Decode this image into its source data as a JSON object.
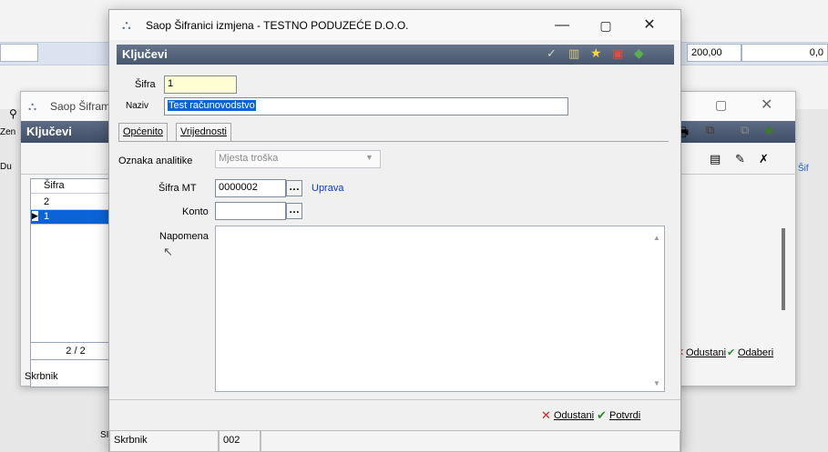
{
  "background": {
    "amount": "200,00",
    "right_amount": "0,0",
    "left_title": "Saop Šifram",
    "left_header": "Ključevi",
    "left_cut_top": "Zen",
    "left_cut_mid": "Du",
    "right_cut": "Šif",
    "grid_header": "Šifra",
    "rows": [
      "2",
      "1"
    ],
    "pager": "2 / 2",
    "footer_label": "Skrbnik",
    "footer_bottom": "SI",
    "buttons": {
      "cancel": "Odustani",
      "choose": "Odaberi"
    }
  },
  "dialog": {
    "title": "Saop Šifranici izmjena  - TESTNO PODUZEĆE D.O.O.",
    "header": "Ključevi",
    "sifra_label": "Šifra",
    "sifra_value": "1",
    "naziv_label": "Naziv",
    "naziv_value": "Test računovodstvo",
    "tabs": [
      "Općenito",
      "Vrijednosti"
    ],
    "oznaka_label": "Oznaka analitike",
    "oznaka_value": "Mjesta troška",
    "sifra_mt_label": "Šifra MT",
    "sifra_mt_value": "0000002",
    "sifra_mt_desc": "Uprava",
    "konto_label": "Konto",
    "napomena_label": "Napomena",
    "cancel": "Odustani",
    "confirm": "Potvrdi",
    "status_label": "Skrbnik",
    "status_value": "002"
  },
  "colors": {
    "header": "#53627a",
    "selection": "#0a64d8",
    "link": "#0a3cc8"
  }
}
